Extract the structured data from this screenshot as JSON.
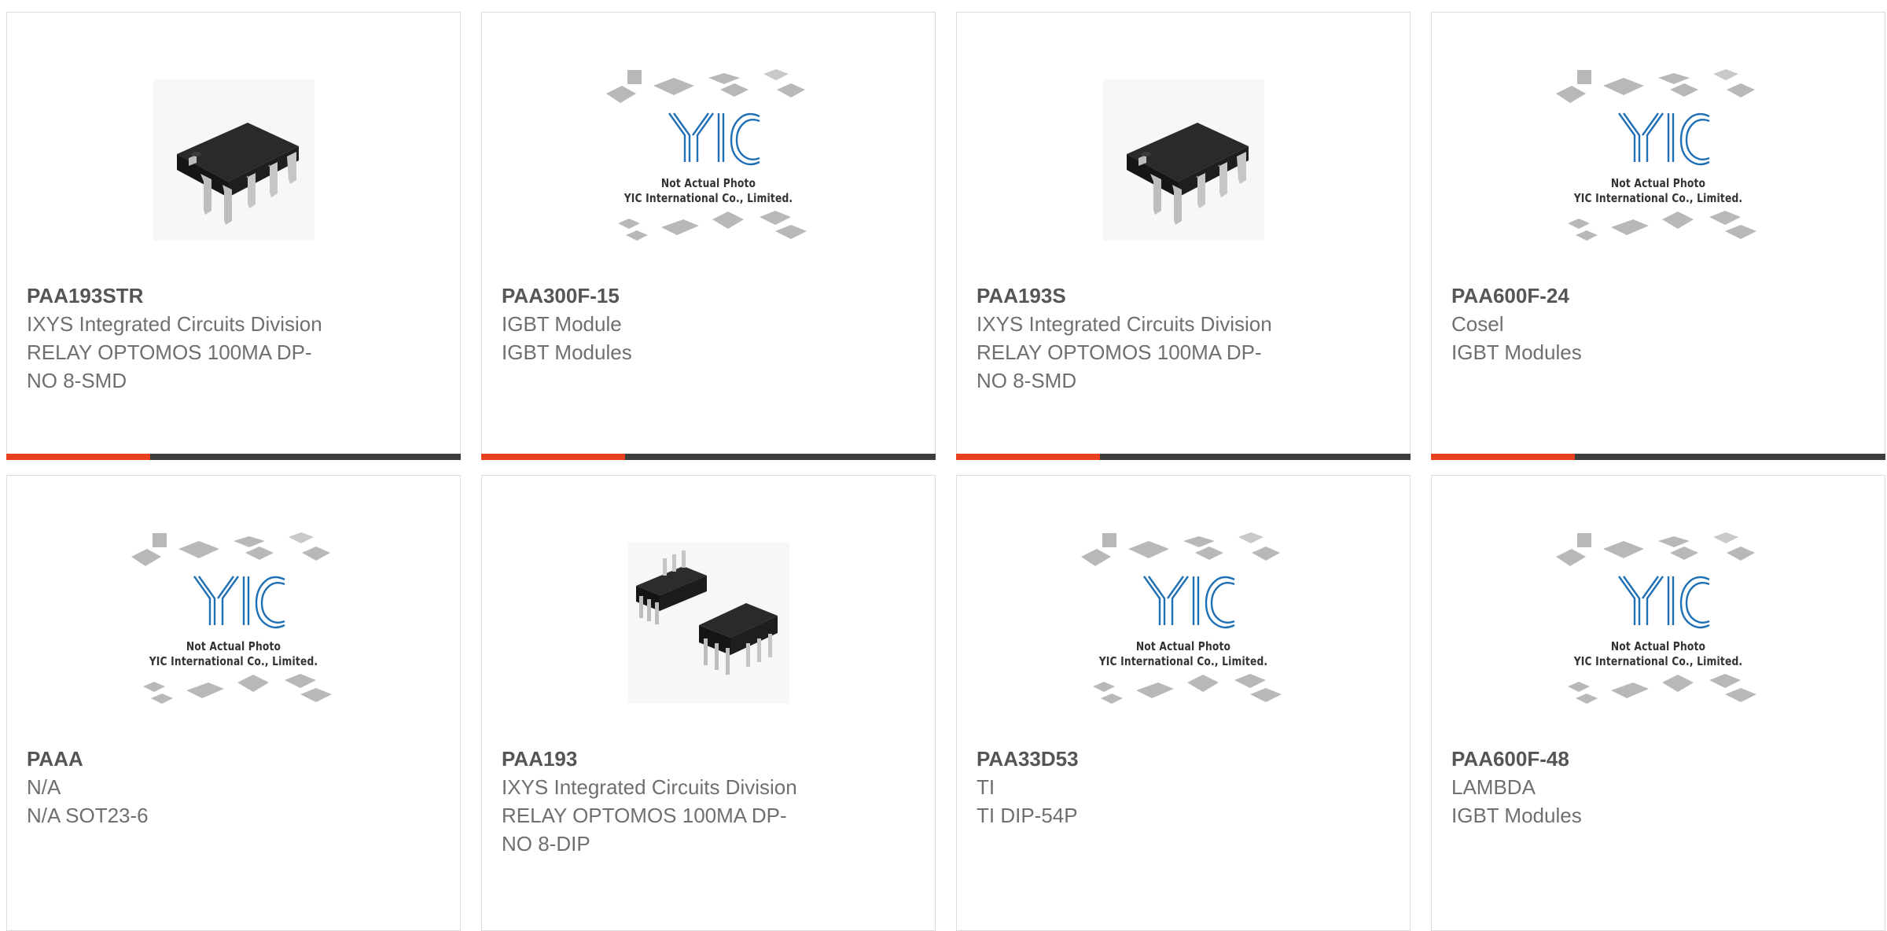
{
  "colors": {
    "accent": "#e8401c",
    "bar_dark": "#3d3d3d",
    "border": "#dcdcdc",
    "title": "#555555",
    "text": "#6f6f6f",
    "yic_blue": "#1f6fb5"
  },
  "placeholder": {
    "brand": "YIC",
    "line1": "Not Actual Photo",
    "line2": "YIC International Co., Limited."
  },
  "products": [
    {
      "part": "PAA193STR",
      "image": "smd-ic-photo",
      "lines": [
        "IXYS Integrated Circuits Division",
        "RELAY OPTOMOS 100MA DP-",
        "NO 8-SMD"
      ]
    },
    {
      "part": "PAA300F-15",
      "image": "placeholder",
      "lines": [
        "IGBT Module",
        "IGBT Modules"
      ]
    },
    {
      "part": "PAA193S",
      "image": "smd-ic-photo",
      "lines": [
        "IXYS Integrated Circuits Division",
        "RELAY OPTOMOS 100MA DP-",
        "NO 8-SMD"
      ]
    },
    {
      "part": "PAA600F-24",
      "image": "placeholder",
      "lines": [
        "Cosel",
        "IGBT Modules"
      ]
    },
    {
      "part": "PAAA",
      "image": "placeholder",
      "lines": [
        "N/A",
        "N/A SOT23-6"
      ]
    },
    {
      "part": "PAA193",
      "image": "dip-ic-photo",
      "lines": [
        "IXYS Integrated Circuits Division",
        "RELAY OPTOMOS 100MA DP-",
        "NO 8-DIP"
      ]
    },
    {
      "part": "PAA33D53",
      "image": "placeholder",
      "lines": [
        "TI",
        "TI DIP-54P"
      ]
    },
    {
      "part": "PAA600F-48",
      "image": "placeholder",
      "lines": [
        "LAMBDA",
        "IGBT Modules"
      ]
    }
  ]
}
